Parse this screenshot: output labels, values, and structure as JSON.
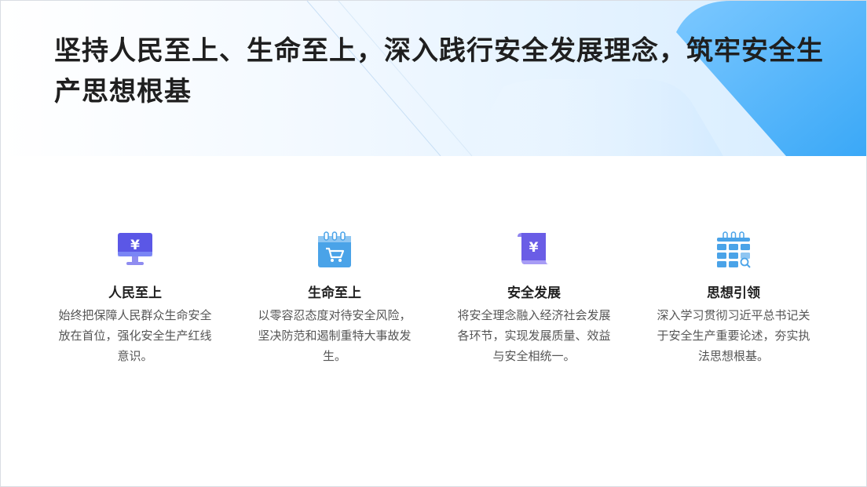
{
  "title": "坚持人民至上、生命至上，深入践行安全发展理念，筑牢安全生产思想根基",
  "features": [
    {
      "icon": "monitor-yuan-icon",
      "heading": "人民至上",
      "text": "始终把保障人民群众生命安全放在首位，强化安全生产红线意识。"
    },
    {
      "icon": "shopping-cart-calendar-icon",
      "heading": "生命至上",
      "text": "以零容忍态度对待安全风险，坚决防范和遏制重特大事故发生。"
    },
    {
      "icon": "yuan-scroll-icon",
      "heading": "安全发展",
      "text": "将安全理念融入经济社会发展各环节，实现发展质量、效益与安全相统一。"
    },
    {
      "icon": "calendar-grid-search-icon",
      "heading": "思想引领",
      "text": "深入学习贯彻习近平总书记关于安全生产重要论述，夯实执法思想根基。"
    }
  ],
  "colors": {
    "title": "#1f1f1f",
    "body_text": "#555555",
    "accent_purple": "#5b57e6",
    "accent_blue": "#4aa3e8"
  }
}
